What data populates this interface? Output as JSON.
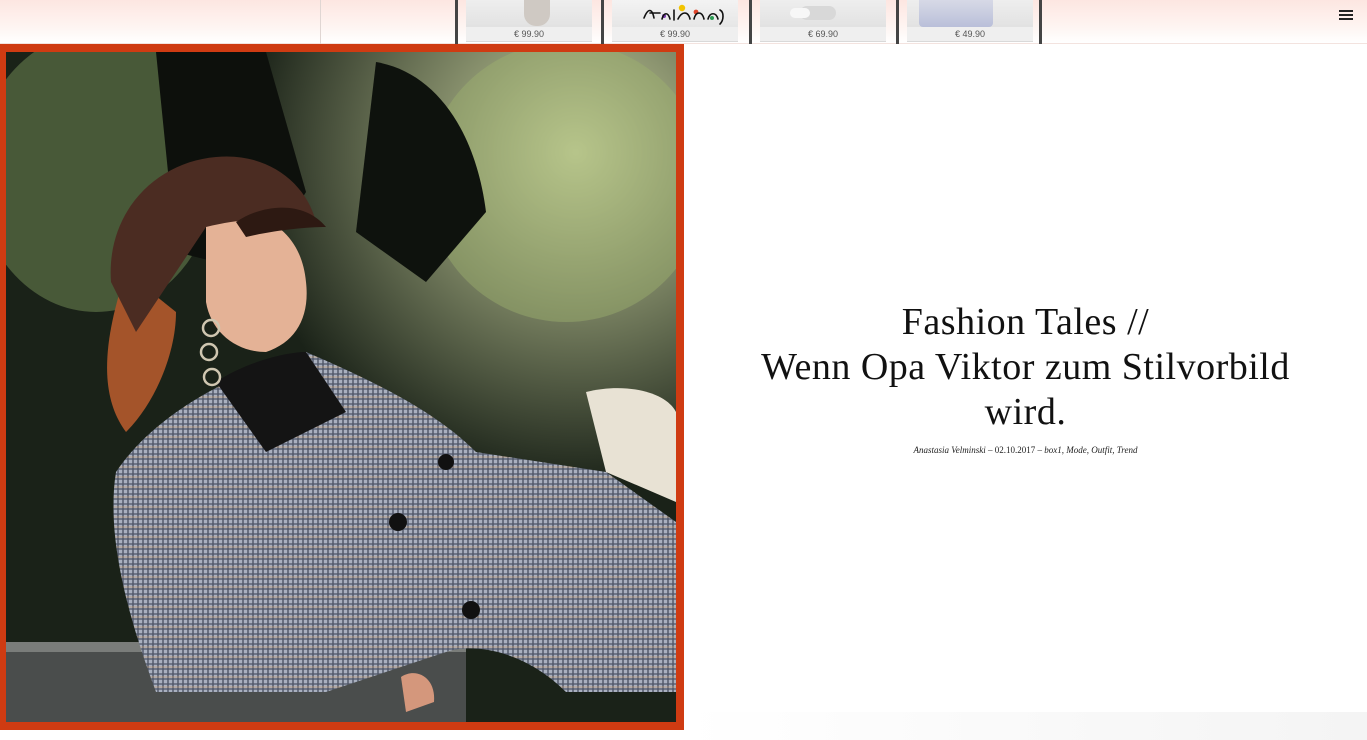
{
  "header": {
    "logo_alt": "This is Jane Wayne",
    "menu_icon": "hamburger-menu-icon",
    "products": [
      {
        "price": "€ 99.90"
      },
      {
        "price": "€ 99.90"
      },
      {
        "price": "€ 69.90"
      },
      {
        "price": "€ 49.90"
      }
    ]
  },
  "article": {
    "title_line1": "Fashion Tales //",
    "title_line2": "Wenn Opa Viktor zum Stilvorbild",
    "title_line3": "wird.",
    "author": "Anastasia Velminski",
    "separator1": " – ",
    "date": "02.10.2017",
    "separator2": " – ",
    "categories": [
      "box1",
      "Mode",
      "Outfit",
      "Trend"
    ]
  },
  "colors": {
    "frame": "#cf3b12",
    "topbar": "#fde6e1"
  }
}
